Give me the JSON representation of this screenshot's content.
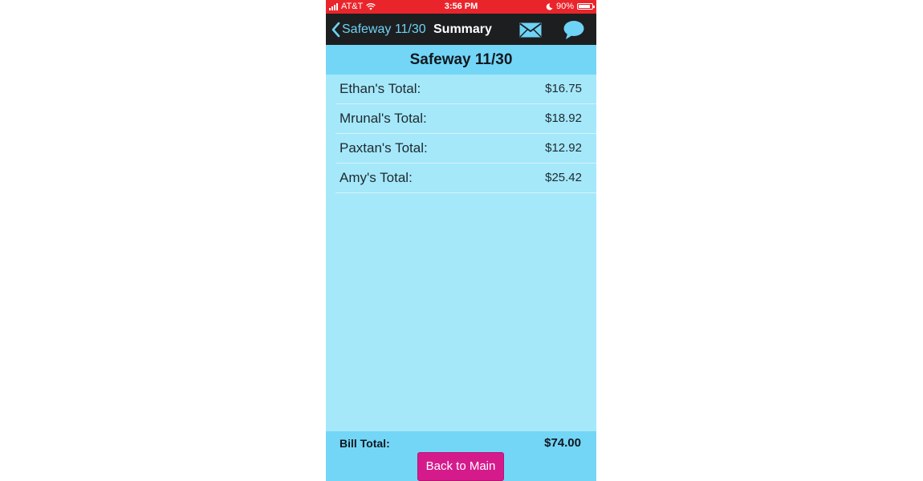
{
  "status_bar": {
    "carrier": "AT&T",
    "time": "3:56 PM",
    "battery": "90%",
    "battery_level": 0.9,
    "icons": [
      "signal-icon",
      "wifi-icon",
      "moon-icon",
      "battery-icon"
    ]
  },
  "nav": {
    "back_label": "Safeway 11/30",
    "title": "Summary",
    "icons": [
      "chevron-left-icon",
      "mail-icon",
      "chat-bubble-icon"
    ]
  },
  "header": {
    "title": "Safeway 11/30"
  },
  "totals": [
    {
      "name": "Ethan's Total:",
      "amount": "$16.75"
    },
    {
      "name": "Mrunal's Total:",
      "amount": "$18.92"
    },
    {
      "name": "Paxtan's Total:",
      "amount": "$12.92"
    },
    {
      "name": "Amy's Total:",
      "amount": "$25.42"
    }
  ],
  "footer": {
    "total_label": "Bill Total:",
    "total_value": "$74.00",
    "back_button": "Back to Main"
  },
  "colors": {
    "status_bar": "#e9252b",
    "nav_bar": "#1d1e20",
    "accent_link": "#6ed3f5",
    "header_bg": "#73d6f6",
    "list_bg": "#a5e8f9",
    "button_bg": "#d51b8c"
  }
}
